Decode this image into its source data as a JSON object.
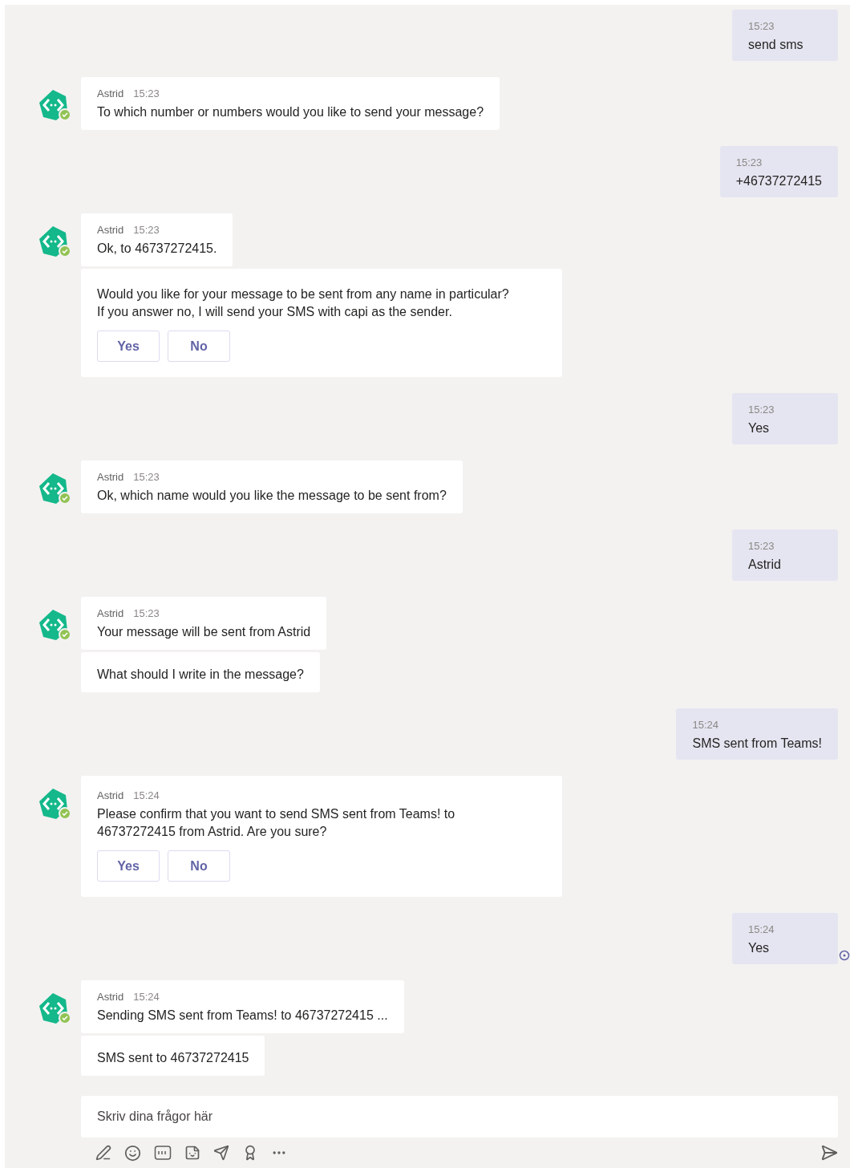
{
  "messages": [
    {
      "kind": "user",
      "time": "15:23",
      "text": "send sms",
      "read": false
    },
    {
      "kind": "bot",
      "sender": "Astrid",
      "time": "15:23",
      "bubbles": [
        {
          "text": "To which number or numbers would you like to send your message?"
        }
      ]
    },
    {
      "kind": "user",
      "time": "15:23",
      "text": "+46737272415",
      "read": false
    },
    {
      "kind": "bot",
      "sender": "Astrid",
      "time": "15:23",
      "bubbles": [
        {
          "text": "Ok, to 46737272415."
        },
        {
          "text": "Would you like for your message to be sent from any name in particular?\nIf you answer no, I will send your SMS with capi as the sender.",
          "buttons": [
            "Yes",
            "No"
          ]
        }
      ]
    },
    {
      "kind": "user",
      "time": "15:23",
      "text": "Yes",
      "read": false
    },
    {
      "kind": "bot",
      "sender": "Astrid",
      "time": "15:23",
      "bubbles": [
        {
          "text": "Ok, which name would you like the message to be sent from?"
        }
      ]
    },
    {
      "kind": "user",
      "time": "15:23",
      "text": "Astrid",
      "read": false
    },
    {
      "kind": "bot",
      "sender": "Astrid",
      "time": "15:23",
      "bubbles": [
        {
          "text": "Your message will be sent from Astrid"
        },
        {
          "text": "What should I write in the message?"
        }
      ]
    },
    {
      "kind": "user",
      "time": "15:24",
      "text": "SMS sent from Teams!",
      "read": false
    },
    {
      "kind": "bot",
      "sender": "Astrid",
      "time": "15:24",
      "bubbles": [
        {
          "text": "Please confirm that you want to send SMS sent from Teams! to\n46737272415 from Astrid. Are you sure?",
          "buttons": [
            "Yes",
            "No"
          ]
        }
      ]
    },
    {
      "kind": "user",
      "time": "15:24",
      "text": "Yes",
      "read": true
    },
    {
      "kind": "bot",
      "sender": "Astrid",
      "time": "15:24",
      "bubbles": [
        {
          "text": "Sending SMS sent from Teams! to 46737272415 ..."
        },
        {
          "text": "SMS sent to 46737272415"
        }
      ]
    }
  ],
  "composer": {
    "placeholder": "Skriv dina frågor här"
  }
}
